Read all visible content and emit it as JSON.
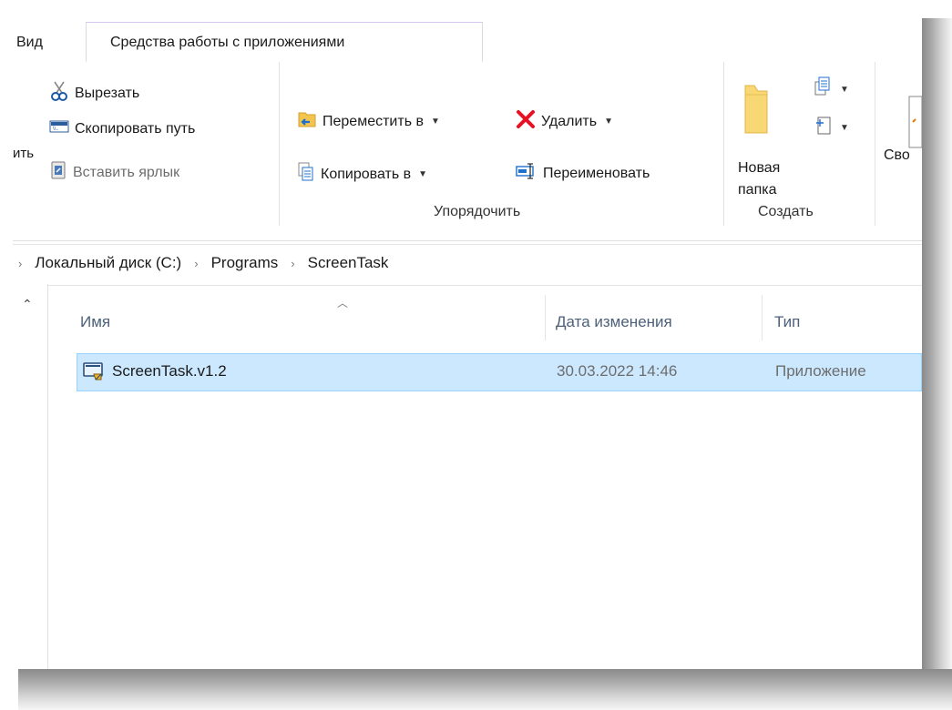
{
  "tabs": {
    "view": "Вид",
    "app_tools": "Средства работы с приложениями"
  },
  "ribbon": {
    "clipboard": {
      "cut": "Вырезать",
      "copy_path": "Скопировать путь",
      "paste_shortcut": "Вставить ярлык",
      "partial_left": "ить"
    },
    "organize": {
      "move_to": "Переместить в",
      "copy_to": "Копировать в",
      "delete": "Удалить",
      "rename": "Переименовать",
      "group_label": "Упорядочить"
    },
    "new": {
      "new_folder_line1": "Новая",
      "new_folder_line2": "папка",
      "group_label": "Создать"
    },
    "open": {
      "properties_partial": "Сво"
    }
  },
  "breadcrumb": [
    "Локальный диск (C:)",
    "Programs",
    "ScreenTask"
  ],
  "columns": {
    "name": "Имя",
    "date": "Дата изменения",
    "type": "Тип"
  },
  "files": [
    {
      "name": "ScreenTask.v1.2",
      "date": "30.03.2022 14:46",
      "type": "Приложение"
    }
  ],
  "colors": {
    "selection": "#cce8ff",
    "selection_border": "#99d1ff",
    "delete_icon": "#e81123",
    "folder": "#f8d775"
  }
}
